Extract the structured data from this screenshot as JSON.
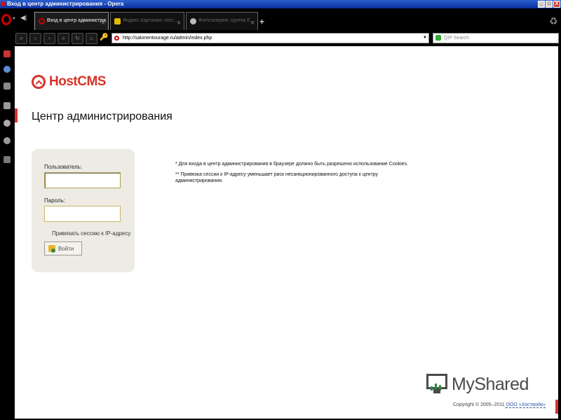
{
  "window": {
    "title": "Вход в центр администрирования - Opera",
    "buttons": {
      "minimize": "_",
      "maximize": "□",
      "close": "X"
    }
  },
  "tabs": [
    {
      "label": "Вход в центр администрирова…",
      "active": true,
      "icon": "opera-page-icon",
      "close": "✕"
    },
    {
      "label": "Яндекс.Картинки: ност…",
      "active": false,
      "icon": "yandex-note-icon",
      "close": "✕"
    },
    {
      "label": "Фотогалерея: группа Е…",
      "active": false,
      "icon": "gallery-icon",
      "close": "✕"
    }
  ],
  "newtab_label": "+",
  "nav": {
    "back": "«",
    "back2": "‹",
    "forward": "›",
    "forward2": "»",
    "reload": "↻",
    "home": "⌂",
    "address": "http://salonentourage.ru/admin/index.php",
    "address_dropdown": "▼",
    "search_placeholder": "QIP Search",
    "search_dropdown": "▼"
  },
  "page": {
    "logo_text": "HostCMS",
    "title": "Центр администрирования",
    "login": {
      "user_label": "Пользователь:",
      "user_value": "",
      "password_label": "Пароль:",
      "password_value": "",
      "bind_ip_label": "Привязать сессию к IP-адресу",
      "submit_label": "Войти"
    },
    "notes": [
      "* Для входа в центр администрирования в браузере должно быть разрешено использование Cookies.",
      "** Привязка сессии к IP-адресу уменьшает риск несанкционированного доступа к центру администрирования."
    ],
    "copyright_prefix": "Copyright © 2005–2011 ",
    "copyright_company": "ООО «Хостмэйк»"
  },
  "watermark": {
    "main": "MyShared",
    "accent_letter": "e"
  },
  "colors": {
    "brand_red": "#d6342b",
    "login_box_bg": "#edebe4",
    "field_border": "#c7b56a"
  }
}
